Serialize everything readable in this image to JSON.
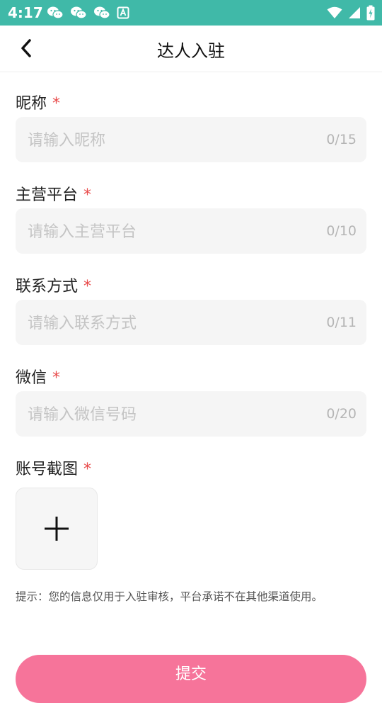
{
  "status_bar": {
    "time": "4:17",
    "left_icons": [
      "wechat-icon",
      "wechat-icon",
      "wechat-icon",
      "text-notification-icon"
    ],
    "right_icons": [
      "wifi-icon",
      "cellular-signal-icon",
      "battery-charging-icon"
    ],
    "background_color": "#40b9a8"
  },
  "app_bar": {
    "title": "达人入驻",
    "back_icon": "chevron-left-icon"
  },
  "form": {
    "required_mark": "*",
    "fields": [
      {
        "label": "昵称",
        "placeholder": "请输入昵称",
        "value": "",
        "counter": "0/15"
      },
      {
        "label": "主营平台",
        "placeholder": "请输入主营平台",
        "value": "",
        "counter": "0/10"
      },
      {
        "label": "联系方式",
        "placeholder": "请输入联系方式",
        "value": "",
        "counter": "0/11"
      },
      {
        "label": "微信",
        "placeholder": "请输入微信号码",
        "value": "",
        "counter": "0/20"
      }
    ],
    "screenshot": {
      "label": "账号截图",
      "upload_icon": "plus-icon"
    },
    "hint": "提示：您的信息仅用于入驻审核，平台承诺不在其他渠道使用。",
    "submit_label": "提交",
    "accent_color": "#f6749a",
    "required_color": "#e84a4a"
  }
}
